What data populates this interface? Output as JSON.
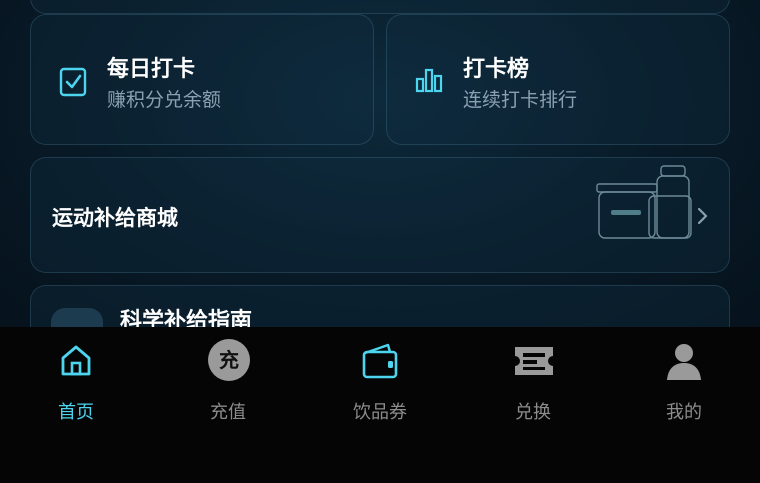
{
  "cards": {
    "daily": {
      "title": "每日打卡",
      "subtitle": "赚积分兑余额",
      "icon": "checkbox-icon"
    },
    "rank": {
      "title": "打卡榜",
      "subtitle": "连续打卡排行",
      "icon": "bar-chart-icon"
    },
    "shop": {
      "title": "运动补给商城",
      "icon": "chevron-right-icon"
    },
    "guide": {
      "title": "科学补给指南"
    }
  },
  "tabbar": {
    "tabs": [
      {
        "label": "首页",
        "icon": "home-icon",
        "active": true
      },
      {
        "label": "充值",
        "icon": "recharge-icon",
        "glyph": "充"
      },
      {
        "label": "饮品券",
        "icon": "wallet-icon"
      },
      {
        "label": "兑换",
        "icon": "ticket-icon"
      },
      {
        "label": "我的",
        "icon": "user-icon"
      }
    ]
  },
  "colors": {
    "accent": "#4dd4ee",
    "inactive": "#8c8c8c",
    "card_text": "#ffffff",
    "card_sub": "#8aa0b0",
    "background": "#06121d"
  }
}
